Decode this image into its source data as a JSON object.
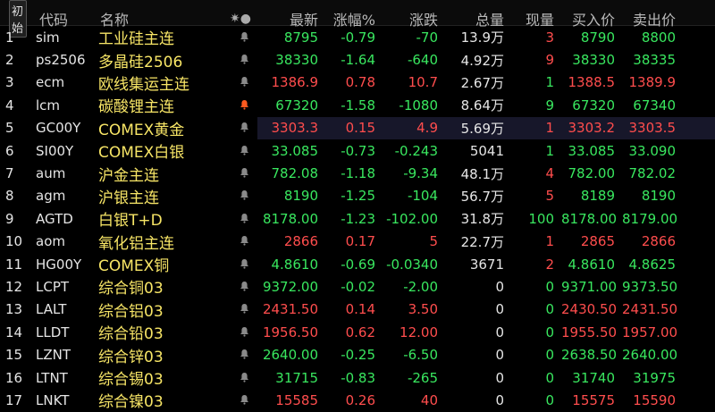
{
  "header": {
    "init_label": "初始",
    "code": "代码",
    "name": "名称",
    "icons": "✷●",
    "latest": "最新",
    "change_pct": "涨幅%",
    "change": "涨跌",
    "volume": "总量",
    "current_vol": "现量",
    "bid": "买入价",
    "ask": "卖出价"
  },
  "colors": {
    "up": "#ff4d4d",
    "down": "#39e75f",
    "name": "#f7e566",
    "bell_gray": "#8a8a8a",
    "bell_active": "#ff5a1f"
  },
  "rows": [
    {
      "idx": "1",
      "code": "sim",
      "name": "工业硅主连",
      "bell": "gray",
      "latest": "8795",
      "pct": "-0.79",
      "chg": "-70",
      "vol": "13.9万",
      "cur": "3",
      "bid": "8790",
      "ask": "8800",
      "dir": "down",
      "cur_dir": "up"
    },
    {
      "idx": "2",
      "code": "ps2506",
      "name": "多晶硅2506",
      "bell": "gray",
      "latest": "38330",
      "pct": "-1.64",
      "chg": "-640",
      "vol": "4.92万",
      "cur": "9",
      "bid": "38330",
      "ask": "38335",
      "dir": "down",
      "cur_dir": "up"
    },
    {
      "idx": "3",
      "code": "ecm",
      "name": "欧线集运主连",
      "bell": "gray",
      "latest": "1386.9",
      "pct": "0.78",
      "chg": "10.7",
      "vol": "2.67万",
      "cur": "1",
      "bid": "1388.5",
      "ask": "1389.9",
      "dir": "up",
      "cur_dir": "down"
    },
    {
      "idx": "4",
      "code": "lcm",
      "name": "碳酸锂主连",
      "bell": "active",
      "latest": "67320",
      "pct": "-1.58",
      "chg": "-1080",
      "vol": "8.64万",
      "cur": "9",
      "bid": "67320",
      "ask": "67340",
      "dir": "down",
      "cur_dir": "down"
    },
    {
      "idx": "5",
      "code": "GC00Y",
      "name": "COMEX黄金",
      "bell": "gray",
      "latest": "3303.3",
      "pct": "0.15",
      "chg": "4.9",
      "vol": "5.69万",
      "cur": "1",
      "bid": "3303.2",
      "ask": "3303.5",
      "dir": "up",
      "cur_dir": "up",
      "highlight": true
    },
    {
      "idx": "6",
      "code": "SI00Y",
      "name": "COMEX白银",
      "bell": "gray",
      "latest": "33.085",
      "pct": "-0.73",
      "chg": "-0.243",
      "vol": "5041",
      "cur": "1",
      "bid": "33.085",
      "ask": "33.090",
      "dir": "down",
      "cur_dir": "down"
    },
    {
      "idx": "7",
      "code": "aum",
      "name": "沪金主连",
      "bell": "gray",
      "latest": "782.08",
      "pct": "-1.18",
      "chg": "-9.34",
      "vol": "48.1万",
      "cur": "4",
      "bid": "782.00",
      "ask": "782.02",
      "dir": "down",
      "cur_dir": "up"
    },
    {
      "idx": "8",
      "code": "agm",
      "name": "沪银主连",
      "bell": "gray",
      "latest": "8190",
      "pct": "-1.25",
      "chg": "-104",
      "vol": "56.7万",
      "cur": "5",
      "bid": "8189",
      "ask": "8190",
      "dir": "down",
      "cur_dir": "up"
    },
    {
      "idx": "9",
      "code": "AGTD",
      "name": "白银T+D",
      "bell": "gray",
      "latest": "8178.00",
      "pct": "-1.23",
      "chg": "-102.00",
      "vol": "31.8万",
      "cur": "100",
      "bid": "8178.00",
      "ask": "8179.00",
      "dir": "down",
      "cur_dir": "down"
    },
    {
      "idx": "10",
      "code": "aom",
      "name": "氧化铝主连",
      "bell": "gray",
      "latest": "2866",
      "pct": "0.17",
      "chg": "5",
      "vol": "22.7万",
      "cur": "1",
      "bid": "2865",
      "ask": "2866",
      "dir": "up",
      "cur_dir": "up"
    },
    {
      "idx": "11",
      "code": "HG00Y",
      "name": "COMEX铜",
      "bell": "gray",
      "latest": "4.8610",
      "pct": "-0.69",
      "chg": "-0.0340",
      "vol": "3671",
      "cur": "2",
      "bid": "4.8610",
      "ask": "4.8625",
      "dir": "down",
      "cur_dir": "up"
    },
    {
      "idx": "12",
      "code": "LCPT",
      "name": "综合铜03",
      "bell": "gray",
      "latest": "9372.00",
      "pct": "-0.02",
      "chg": "-2.00",
      "vol": "0",
      "cur": "0",
      "bid": "9371.00",
      "ask": "9373.50",
      "dir": "down",
      "cur_dir": "down"
    },
    {
      "idx": "13",
      "code": "LALT",
      "name": "综合铝03",
      "bell": "gray",
      "latest": "2431.50",
      "pct": "0.14",
      "chg": "3.50",
      "vol": "0",
      "cur": "0",
      "bid": "2430.50",
      "ask": "2431.50",
      "dir": "up",
      "cur_dir": "down"
    },
    {
      "idx": "14",
      "code": "LLDT",
      "name": "综合铅03",
      "bell": "gray",
      "latest": "1956.50",
      "pct": "0.62",
      "chg": "12.00",
      "vol": "0",
      "cur": "0",
      "bid": "1955.50",
      "ask": "1957.00",
      "dir": "up",
      "cur_dir": "down"
    },
    {
      "idx": "15",
      "code": "LZNT",
      "name": "综合锌03",
      "bell": "gray",
      "latest": "2640.00",
      "pct": "-0.25",
      "chg": "-6.50",
      "vol": "0",
      "cur": "0",
      "bid": "2638.50",
      "ask": "2640.00",
      "dir": "down",
      "cur_dir": "down"
    },
    {
      "idx": "16",
      "code": "LTNT",
      "name": "综合锡03",
      "bell": "gray",
      "latest": "31715",
      "pct": "-0.83",
      "chg": "-265",
      "vol": "0",
      "cur": "0",
      "bid": "31740",
      "ask": "31975",
      "dir": "down",
      "cur_dir": "down"
    },
    {
      "idx": "17",
      "code": "LNKT",
      "name": "综合镍03",
      "bell": "gray",
      "latest": "15585",
      "pct": "0.26",
      "chg": "40",
      "vol": "0",
      "cur": "0",
      "bid": "15575",
      "ask": "15590",
      "dir": "up",
      "cur_dir": "down"
    }
  ]
}
